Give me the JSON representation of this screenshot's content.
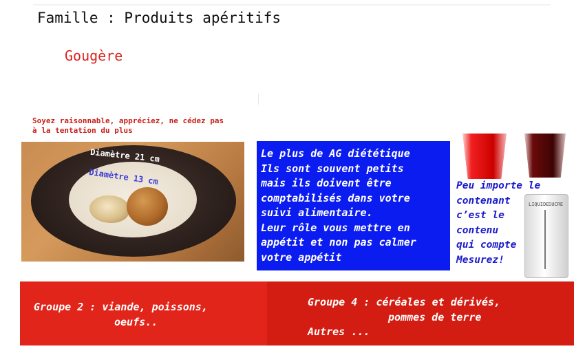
{
  "header": {
    "title": "Famille : Produits apéritifs",
    "product": "Gougère"
  },
  "advice": "Soyez raisonnable, appréciez, ne cédez pas à la tentation du plus",
  "photo": {
    "diameter_plate": "Diamètre 21 cm",
    "diameter_inner": "Diamètre 13 cm"
  },
  "info_box": {
    "lines": [
      "Le plus de AG diététique",
      "Ils sont souvent petits",
      "mais ils doivent être",
      "comptabilisés dans votre",
      "suivi alimentaire.",
      "Leur rôle vous mettre en",
      "appétit et non pas calmer",
      "votre appétit"
    ]
  },
  "measure": {
    "lines": [
      "Peu importe le",
      "contenant",
      "c’est le",
      "contenu",
      "qui compte",
      "Mesurez!"
    ],
    "jug_label_left": "LIQUIDE",
    "jug_label_right": "SUCRE"
  },
  "groups": {
    "left": [
      "Groupe 2 : viande, poissons,",
      "oeufs.."
    ],
    "right": [
      "Groupe 4 : céréales et dérivés,",
      "pommes de terre",
      "Autres ..."
    ]
  },
  "colors": {
    "accent_red": "#e1251a",
    "info_blue": "#0b1cf0",
    "measure_text": "#1a1acc"
  }
}
